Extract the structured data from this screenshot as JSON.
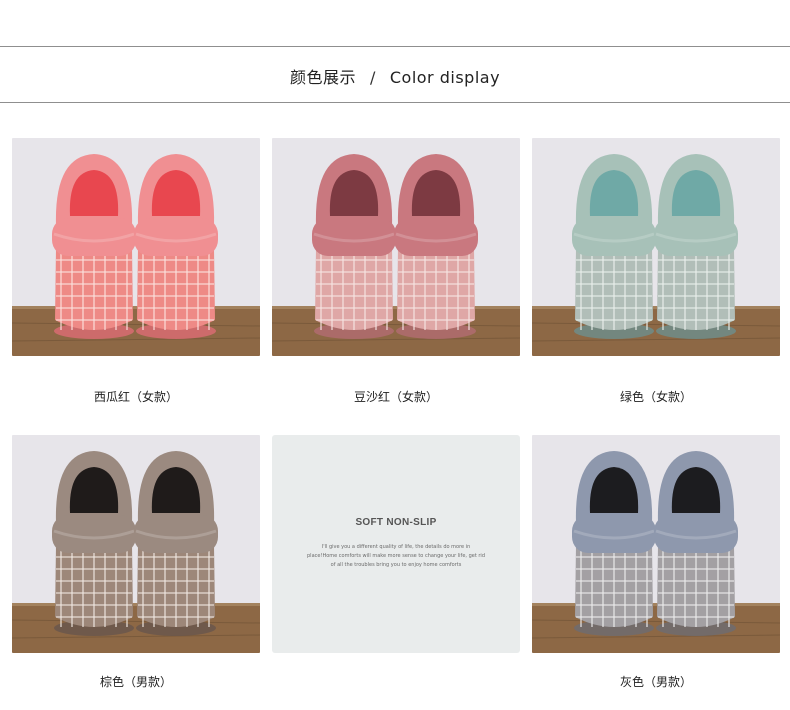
{
  "header": {
    "title_cn": "颜色展示",
    "separator": "/",
    "title_en": "Color display"
  },
  "products": [
    {
      "caption": "西瓜红（女款）",
      "colors": {
        "fur": "#f08f92",
        "inner": "#e8474f",
        "body": "#ee8a86",
        "grid": "#fbe1dd",
        "sole": "#d86c72"
      }
    },
    {
      "caption": "豆沙红（女款）",
      "colors": {
        "fur": "#c9787f",
        "inner": "#7d3a42",
        "body": "#dfa7a6",
        "grid": "#f6e4e2",
        "sole": "#b06c70"
      }
    },
    {
      "caption": "绿色（女款）",
      "colors": {
        "fur": "#a7c1b8",
        "inner": "#6fa9a6",
        "body": "#b1beb8",
        "grid": "#e9efec",
        "sole": "#6e8d8a"
      }
    },
    {
      "caption": "棕色（男款）",
      "colors": {
        "fur": "#9b8a80",
        "inner": "#1f1b1a",
        "body": "#9d8779",
        "grid": "#efe6df",
        "sole": "#6a574c"
      }
    },
    {
      "caption": "灰色（男款）",
      "colors": {
        "fur": "#8e98ad",
        "inner": "#1c1c1f",
        "body": "#a3a0a3",
        "grid": "#ecebec",
        "sole": "#6f6c70"
      }
    }
  ],
  "promo": {
    "title": "SOFT NON-SLIP",
    "body": "I'll give you a different quality of life, the details do more in place!Home comforts will make more sense to change your life, get rid of all the troubles bring you to enjoy home comforts"
  }
}
